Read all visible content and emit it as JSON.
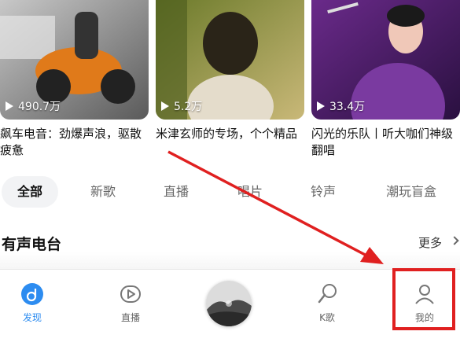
{
  "cards": [
    {
      "play_count": "490.7万",
      "title": "飙车电音：劲爆声浪，驱散疲惫"
    },
    {
      "play_count": "5.2万",
      "title": "米津玄师的专场，个个精品"
    },
    {
      "play_count": "33.4万",
      "title": "闪光的乐队丨听大咖们神级翻唱"
    }
  ],
  "tabs": [
    {
      "label": "全部"
    },
    {
      "label": "新歌"
    },
    {
      "label": "直播"
    },
    {
      "label": "唱片"
    },
    {
      "label": "铃声"
    },
    {
      "label": "潮玩盲盒"
    }
  ],
  "section": {
    "title": "有声电台",
    "more_label": "更多"
  },
  "bottom_nav": [
    {
      "label": "发现",
      "icon": "discover-icon"
    },
    {
      "label": "直播",
      "icon": "live-play-icon"
    },
    {
      "label": "",
      "icon": "now-playing-disc"
    },
    {
      "label": "K歌",
      "icon": "microphone-icon"
    },
    {
      "label": "我的",
      "icon": "profile-icon"
    }
  ],
  "colors": {
    "accent": "#2d8cf0",
    "annotation": "#e02020"
  }
}
